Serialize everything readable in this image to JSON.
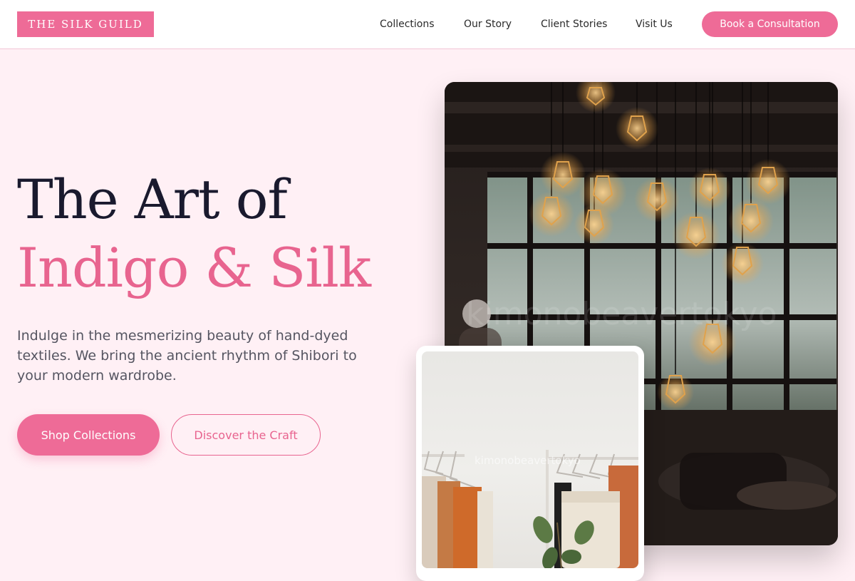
{
  "brand": {
    "logo_text": "THE SILK GUILD"
  },
  "nav": {
    "links": [
      "Collections",
      "Our Story",
      "Client Stories",
      "Visit Us"
    ],
    "cta": "Book a Consultation"
  },
  "hero": {
    "title_line1": "The Art of",
    "title_line2": "Indigo & Silk",
    "description": "Indulge in the mesmerizing beauty of hand-dyed textiles. We bring the ancient rhythm of Shibori to your modern wardrobe.",
    "primary_button": "Shop Collections",
    "secondary_button": "Discover the Craft"
  },
  "images": {
    "main_watermark": "kimonobeavertokyo",
    "sub_watermark": "kimonobeavertokyo"
  },
  "colors": {
    "accent": "#ee6b97",
    "accent_text": "#e8648f",
    "page_bg": "#fff0f5",
    "heading": "#1a1a2e",
    "body_text": "#555561"
  }
}
